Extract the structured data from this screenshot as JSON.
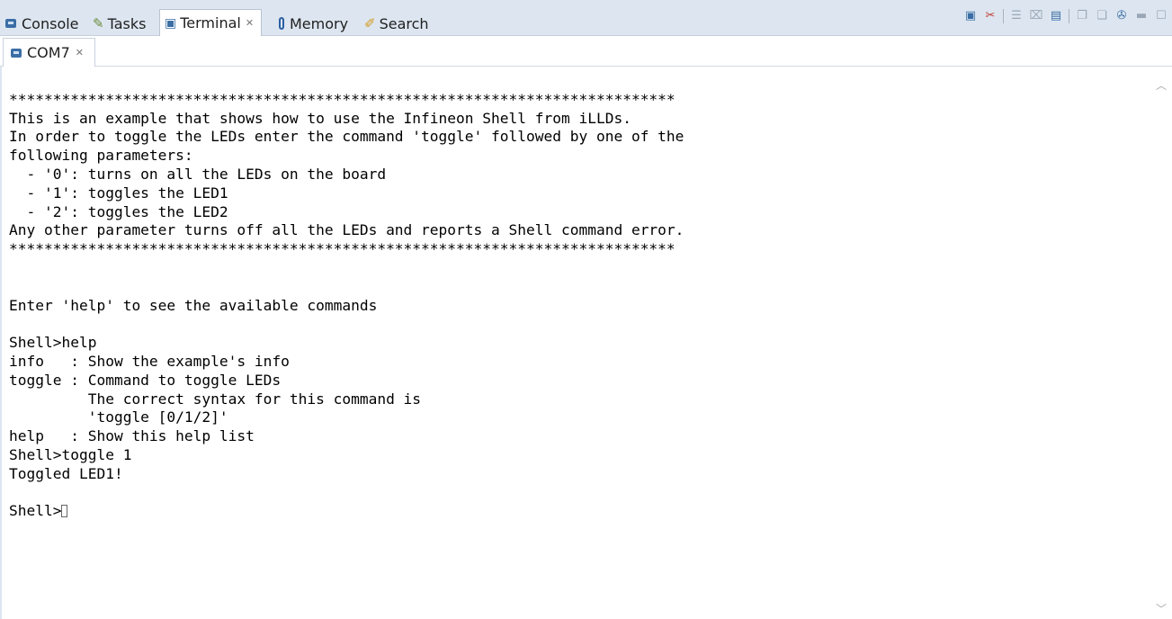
{
  "tabs": [
    {
      "label": "Console",
      "icon": "console-icon"
    },
    {
      "label": "Tasks",
      "icon": "tasks-icon"
    },
    {
      "label": "Terminal",
      "icon": "terminal-icon",
      "active": true,
      "close": "✕"
    },
    {
      "label": "Memory",
      "icon": "memory-icon"
    },
    {
      "label": "Search",
      "icon": "search-icon"
    }
  ],
  "toolbar": {
    "icons": [
      "new-terminal-icon",
      "disconnect-icon",
      "settings-icon",
      "clear-icon",
      "scroll-lock-icon",
      "copy-icon",
      "paste-icon",
      "pin-icon",
      "minimize-icon",
      "maximize-icon"
    ]
  },
  "subtab": {
    "label": "COM7",
    "close": "✕"
  },
  "terminal": {
    "lines": [
      "",
      "****************************************************************************",
      "This is an example that shows how to use the Infineon Shell from iLLDs.",
      "In order to toggle the LEDs enter the command 'toggle' followed by one of the",
      "following parameters:",
      "  - '0': turns on all the LEDs on the board",
      "  - '1': toggles the LED1",
      "  - '2': toggles the LED2",
      "Any other parameter turns off all the LEDs and reports a Shell command error.",
      "****************************************************************************",
      "",
      "",
      "Enter 'help' to see the available commands",
      "",
      "Shell>help",
      "info   : Show the example's info",
      "toggle : Command to toggle LEDs",
      "         The correct syntax for this command is",
      "         'toggle [0/1/2]'",
      "help   : Show this help list",
      "Shell>toggle 1",
      "Toggled LED1!",
      ""
    ],
    "prompt": "Shell>"
  }
}
